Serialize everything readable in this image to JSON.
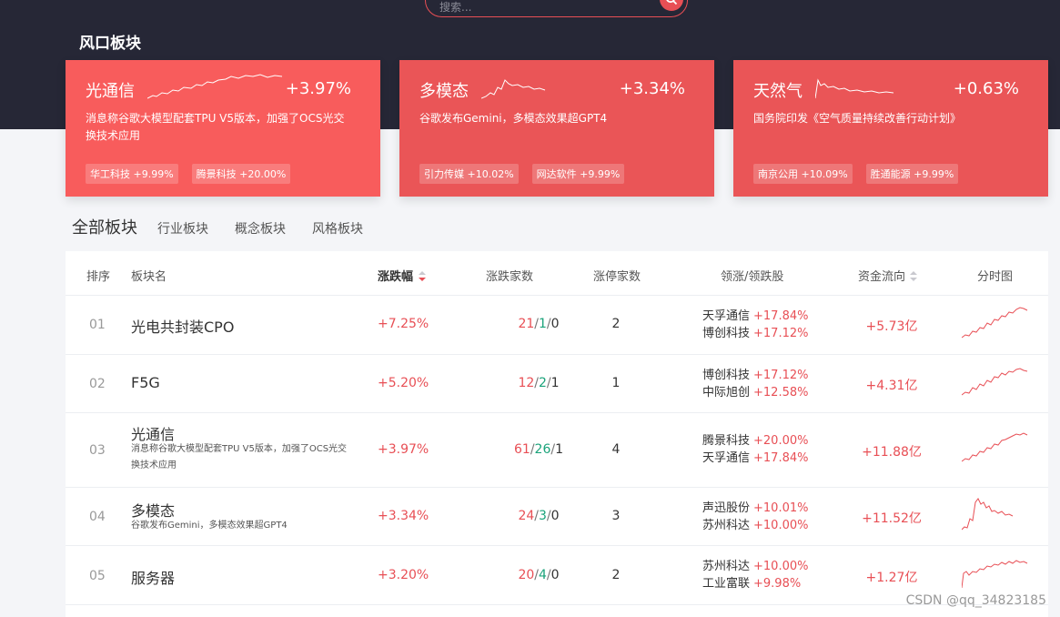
{
  "search": {
    "placeholder": "搜索..."
  },
  "hot": {
    "title": "风口板块",
    "cards": [
      {
        "name": "光通信",
        "pct": "+3.97%",
        "desc": "消息称谷歌大模型配套TPU V5版本，加强了OCS光交换技术应用",
        "stocks": [
          "华工科技 +9.99%",
          "腾景科技 +20.00%"
        ],
        "color": "#f85c5c"
      },
      {
        "name": "多模态",
        "pct": "+3.34%",
        "desc": "谷歌发布Gemini，多模态效果超GPT4",
        "stocks": [
          "引力传媒 +10.02%",
          "网达软件 +9.99%"
        ],
        "color": "#ea5557"
      },
      {
        "name": "天然气",
        "pct": "+0.63%",
        "desc": "国务院印发《空气质量持续改善行动计划》",
        "stocks": [
          "南京公用 +10.09%",
          "胜通能源 +9.99%"
        ],
        "color": "#ea5557"
      }
    ]
  },
  "tabs": {
    "main": "全部板块",
    "items": [
      "行业板块",
      "概念板块",
      "风格板块"
    ]
  },
  "table": {
    "headers": {
      "rank": "排序",
      "name": "板块名",
      "pct": "涨跌幅",
      "count": "涨跌家数",
      "limit": "涨停家数",
      "leaders": "领涨/领跌股",
      "flow": "资金流向",
      "chart": "分时图"
    },
    "rows": [
      {
        "rank": "01",
        "name": "光电共封装CPO",
        "sub": "",
        "pct": "+7.25%",
        "up": "21",
        "flat": "1",
        "down": "0",
        "limit": "2",
        "leaders": [
          [
            "天孚通信",
            "+17.84%"
          ],
          [
            "博创科技",
            "+17.12%"
          ]
        ],
        "flow": "+5.73亿"
      },
      {
        "rank": "02",
        "name": "F5G",
        "sub": "",
        "pct": "+5.20%",
        "up": "12",
        "flat": "2",
        "down": "1",
        "limit": "1",
        "leaders": [
          [
            "博创科技",
            "+17.12%"
          ],
          [
            "中际旭创",
            "+12.58%"
          ]
        ],
        "flow": "+4.31亿"
      },
      {
        "rank": "03",
        "name": "光通信",
        "sub": "消息称谷歌大模型配套TPU V5版本，加强了OCS光交换技术应用",
        "pct": "+3.97%",
        "up": "61",
        "flat": "26",
        "down": "1",
        "limit": "4",
        "leaders": [
          [
            "腾景科技",
            "+20.00%"
          ],
          [
            "天孚通信",
            "+17.84%"
          ]
        ],
        "flow": "+11.88亿"
      },
      {
        "rank": "04",
        "name": "多模态",
        "sub": "谷歌发布Gemini，多模态效果超GPT4",
        "pct": "+3.34%",
        "up": "24",
        "flat": "3",
        "down": "0",
        "limit": "3",
        "leaders": [
          [
            "声迅股份",
            "+10.01%"
          ],
          [
            "苏州科达",
            "+10.00%"
          ]
        ],
        "flow": "+11.52亿"
      },
      {
        "rank": "05",
        "name": "服务器",
        "sub": "",
        "pct": "+3.20%",
        "up": "20",
        "flat": "4",
        "down": "0",
        "limit": "2",
        "leaders": [
          [
            "苏州科达",
            "+10.00%"
          ],
          [
            "工业富联",
            "+9.98%"
          ]
        ],
        "flow": "+1.27亿"
      }
    ]
  },
  "watermark": "CSDN @qq_34823185",
  "colors": {
    "accent": "#e84f55",
    "green": "#1aa37a",
    "dark": "#262736"
  }
}
